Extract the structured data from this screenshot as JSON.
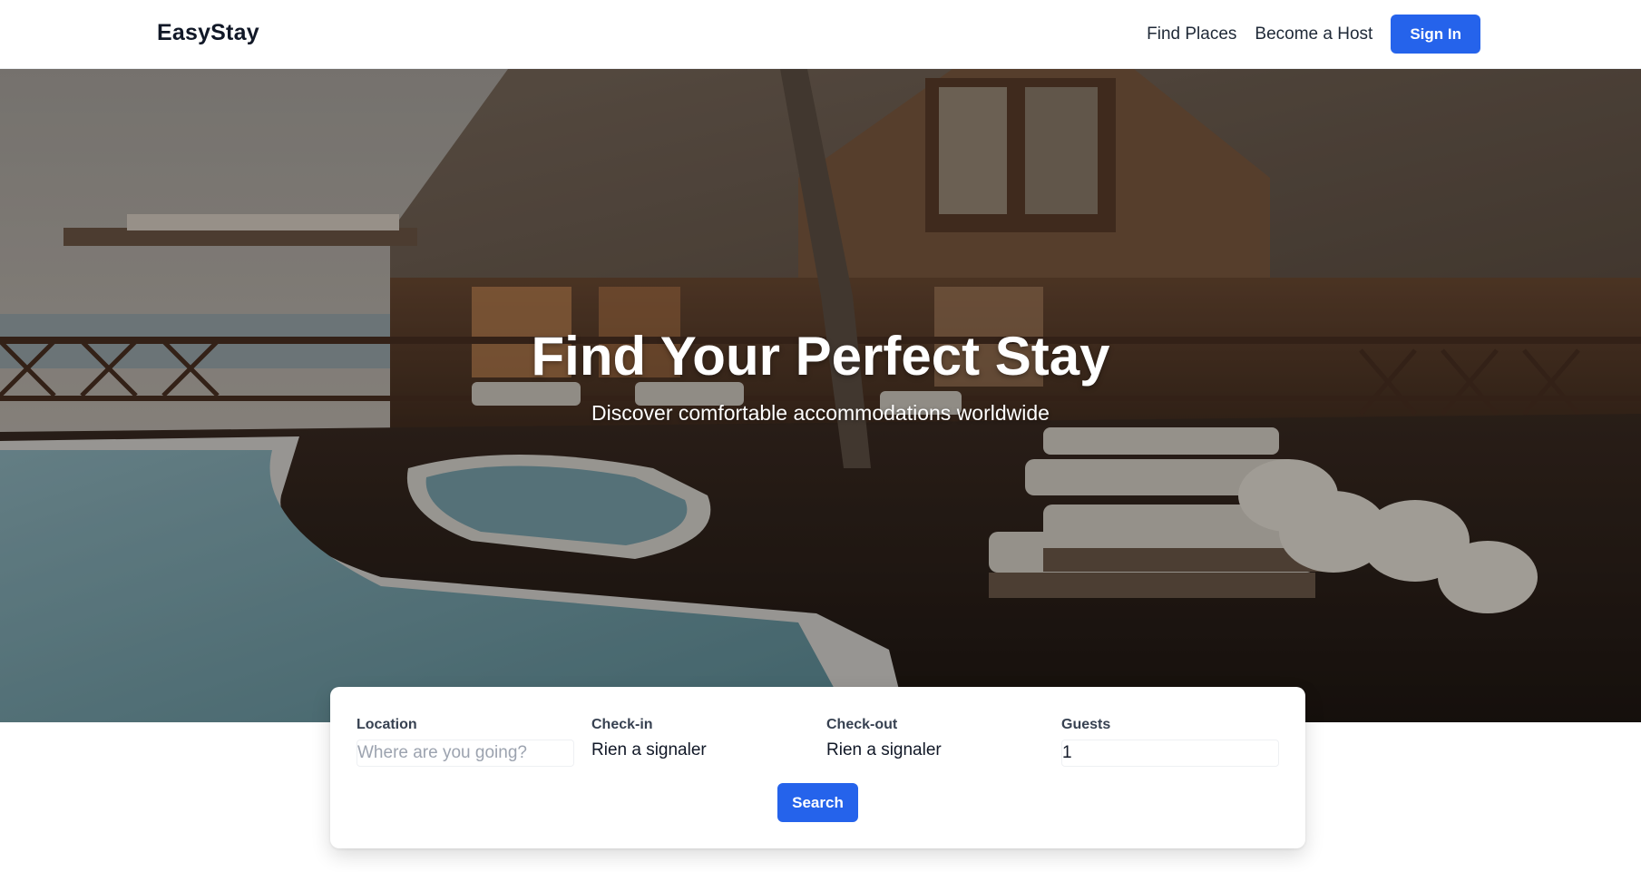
{
  "nav": {
    "brand": "EasyStay",
    "links": [
      "Find Places",
      "Become a Host"
    ],
    "signin_label": "Sign In"
  },
  "hero": {
    "title": "Find Your Perfect Stay",
    "subtitle": "Discover comfortable accommodations worldwide"
  },
  "search": {
    "location": {
      "label": "Location",
      "placeholder": "Where are you going?",
      "value": ""
    },
    "checkin": {
      "label": "Check-in",
      "value": "Rien a signaler"
    },
    "checkout": {
      "label": "Check-out",
      "value": "Rien a signaler"
    },
    "guests": {
      "label": "Guests",
      "value": "1"
    },
    "button_label": "Search"
  },
  "colors": {
    "primary": "#2563eb",
    "text": "#111827",
    "white": "#ffffff"
  }
}
